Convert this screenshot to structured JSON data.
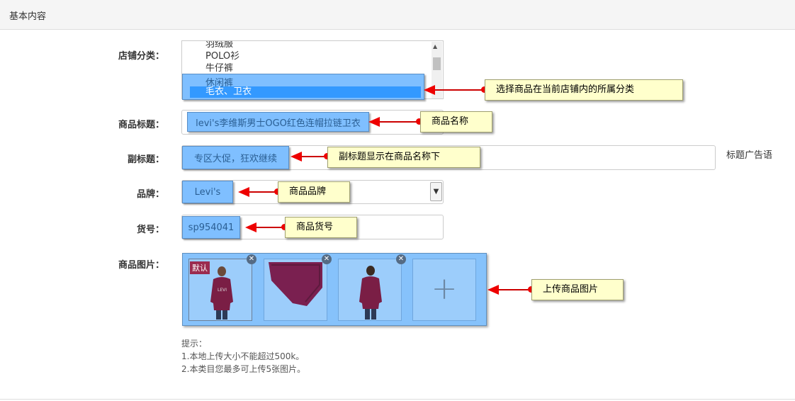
{
  "panel": {
    "title": "基本内容"
  },
  "fields": {
    "category": {
      "label": "店铺分类：",
      "options": [
        "羽绒服",
        "POLO衫",
        "牛仔裤",
        "休闲裤",
        "毛衣、卫衣"
      ],
      "selected": "毛衣、卫衣"
    },
    "title": {
      "label": "商品标题：",
      "value": "levi's李维斯男士OGO红色连帽拉链卫衣"
    },
    "subtitle": {
      "label": "副标题：",
      "value": "专区大促，狂欢继续",
      "side_text": "标题广告语"
    },
    "brand": {
      "label": "品牌：",
      "value": "Levi's"
    },
    "sku": {
      "label": "货号：",
      "value": "sp954041"
    },
    "images": {
      "label": "商品图片：",
      "default_tag": "默认",
      "add_symbol": "+"
    }
  },
  "callouts": {
    "category": "选择商品在当前店铺内的所属分类",
    "title": "商品名称",
    "subtitle": "副标题显示在商品名称下",
    "brand": "商品品牌",
    "sku": "商品货号",
    "images": "上传商品图片"
  },
  "hints": {
    "heading": "提示：",
    "line1": "1.本地上传大小不能超过500k。",
    "line2": "2.本类目您最多可上传5张图片。"
  },
  "colors": {
    "highlight": "#7fbfff",
    "note": "#ffffcc",
    "arrow": "#ee0000",
    "selected_option": "#3399ff",
    "default_tag": "#9b2b4f"
  }
}
